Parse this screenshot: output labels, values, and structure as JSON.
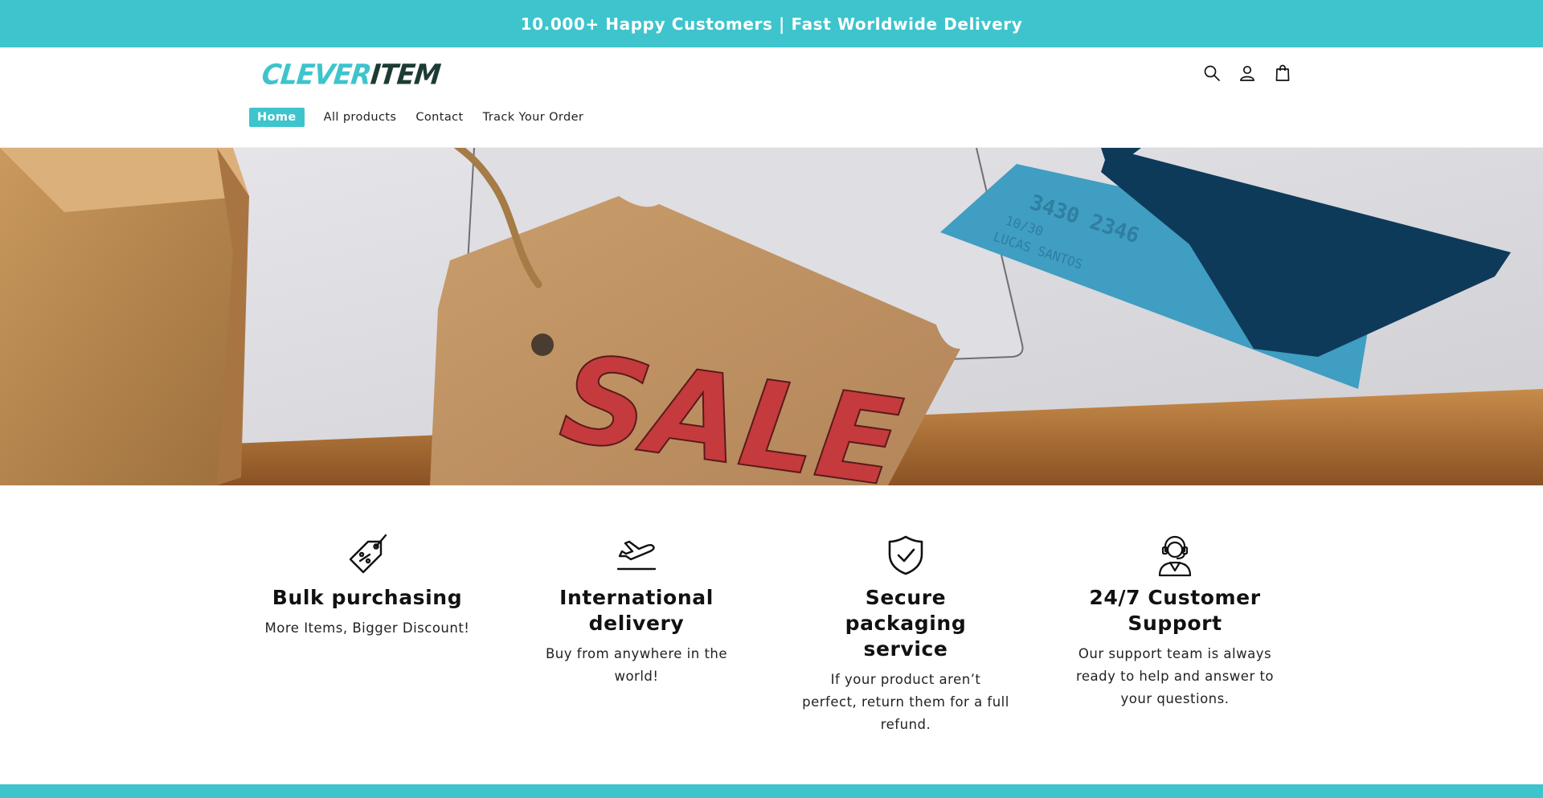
{
  "announcement": {
    "text": "10.000+ Happy Customers | Fast Worldwide Delivery"
  },
  "header": {
    "logo_part1": "CLEVER",
    "logo_part2": "ITEM",
    "icons": [
      "search-icon",
      "account-icon",
      "cart-icon"
    ]
  },
  "nav": {
    "items": [
      {
        "label": "Home",
        "active": true
      },
      {
        "label": "All products"
      },
      {
        "label": "Contact"
      },
      {
        "label": "Track Your Order"
      }
    ]
  },
  "hero": {
    "tag_text": "SALE"
  },
  "features": [
    {
      "icon": "price-tag-icon",
      "title": "Bulk purchasing",
      "text": "More Items, Bigger Discount!"
    },
    {
      "icon": "airplane-icon",
      "title": "International delivery",
      "text": "Buy from anywhere in the world!"
    },
    {
      "icon": "shield-check-icon",
      "title": "Secure packaging service",
      "text": "If your product aren’t perfect, return them for a full refund."
    },
    {
      "icon": "headset-support-icon",
      "title": "24/7 Customer Support",
      "text": "Our support team is always ready to help and answer to your questions."
    }
  ],
  "colors": {
    "accent": "#3ec4cc",
    "logo_dark": "#1d3b34",
    "tag_red": "#c43a3d"
  }
}
